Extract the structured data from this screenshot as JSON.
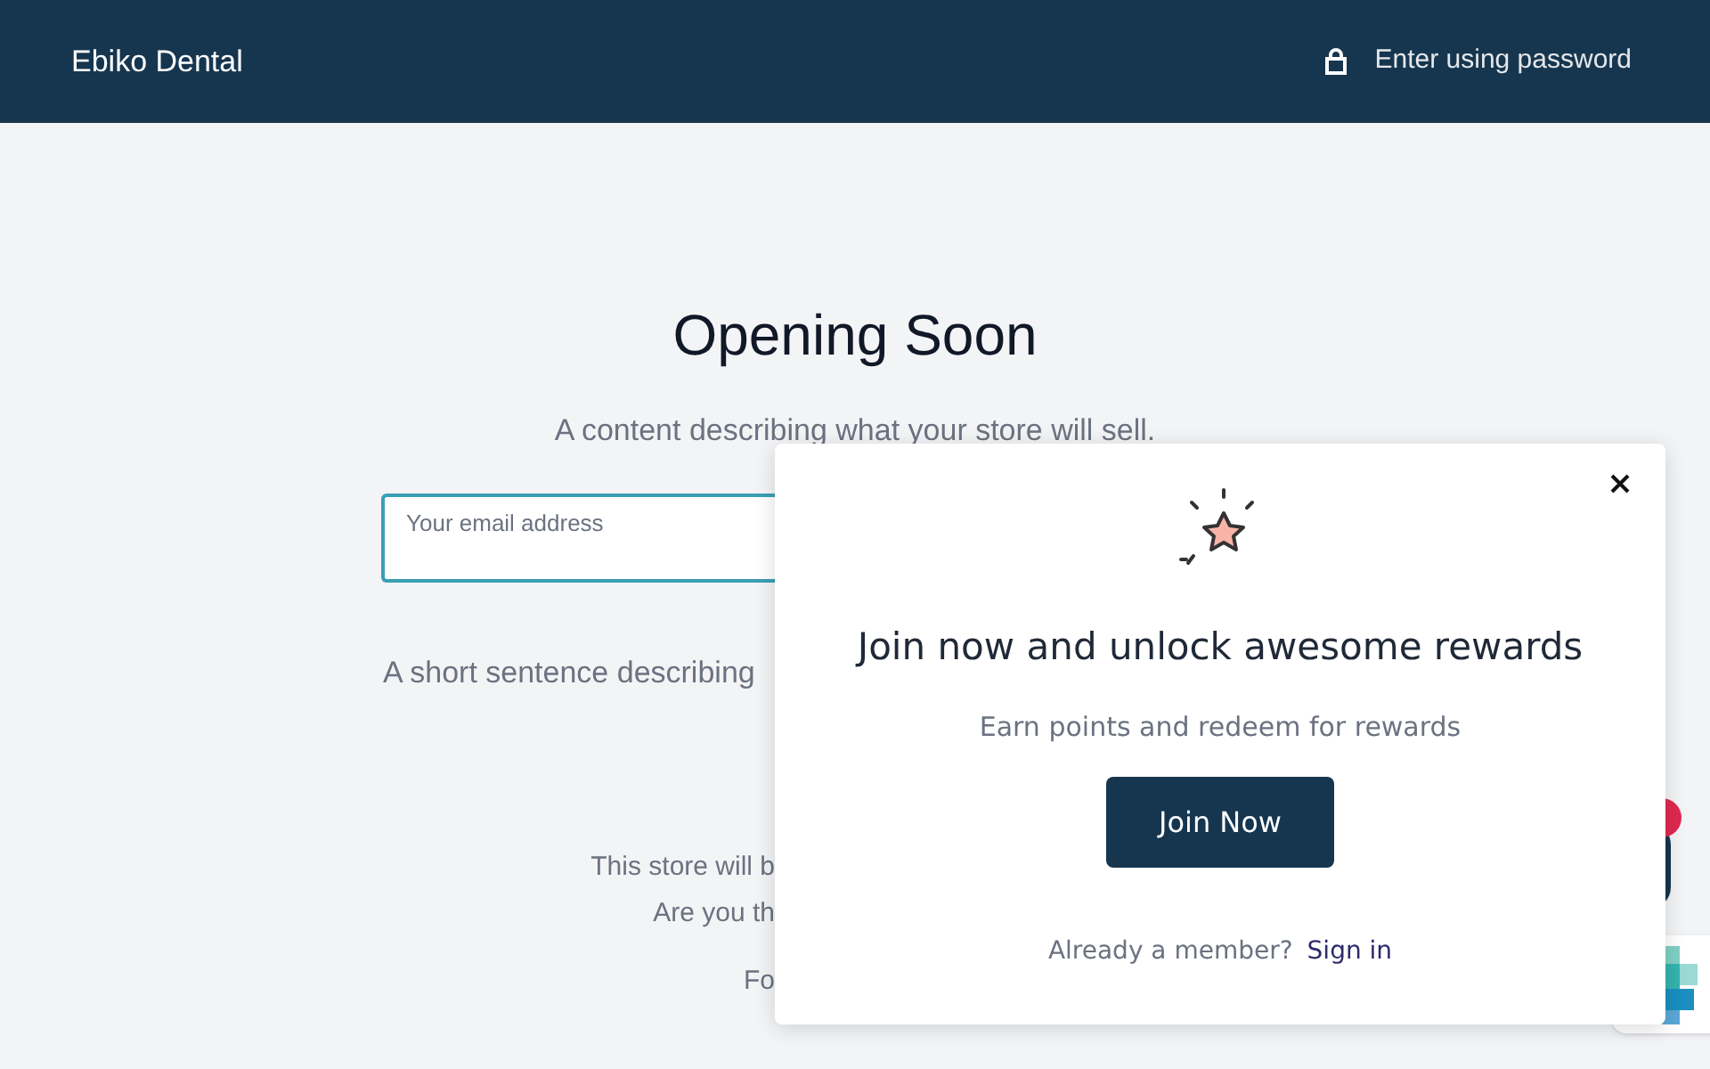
{
  "header": {
    "store_name": "Ebiko Dental",
    "password_link": "Enter using password"
  },
  "main": {
    "title": "Opening Soon",
    "description": "A content describing what your store will sell.",
    "email_field": {
      "placeholder": "Your email address"
    },
    "short_sentence": "A short sentence describing",
    "notice_lines": [
      "This store will b",
      "Are you th"
    ],
    "footer_text": "Fo"
  },
  "popup": {
    "title": "Join now and unlock awesome rewards",
    "subtitle": "Earn points and redeem for rewards",
    "button": "Join Now",
    "member_text": "Already a member?",
    "sign_in": "Sign in"
  }
}
